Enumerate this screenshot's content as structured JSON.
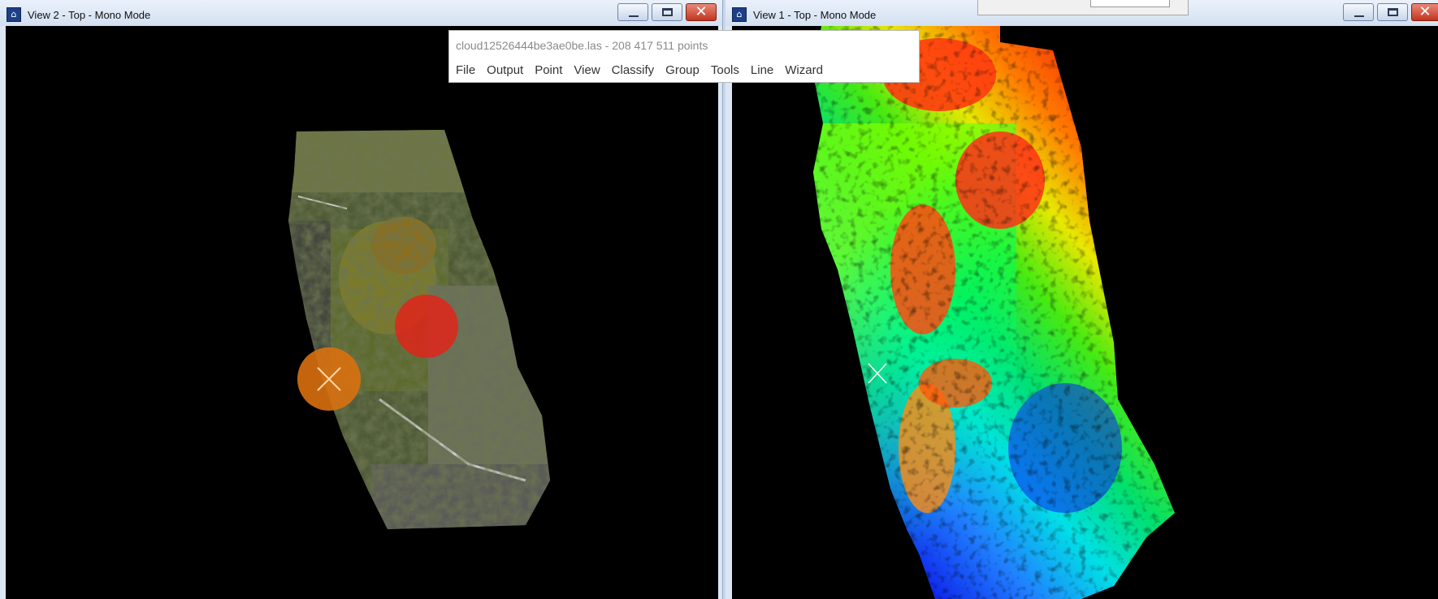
{
  "left_window": {
    "title": "View 2 - Top - Mono Mode",
    "icon": "app-icon",
    "controls": [
      "minimize-icon",
      "maximize-icon",
      "close-icon"
    ]
  },
  "right_window": {
    "title": "View 1 - Top - Mono Mode",
    "icon": "app-icon",
    "controls": [
      "minimize-icon",
      "maximize-icon",
      "close-icon"
    ]
  },
  "popup": {
    "title": "cloud12526444be3ae0be.las - 208 417 511 points",
    "menu": [
      "File",
      "Output",
      "Point",
      "View",
      "Classify",
      "Group",
      "Tools",
      "Line",
      "Wizard"
    ]
  },
  "markers": {
    "red": "#e0241a",
    "orange": "#d9700f"
  }
}
